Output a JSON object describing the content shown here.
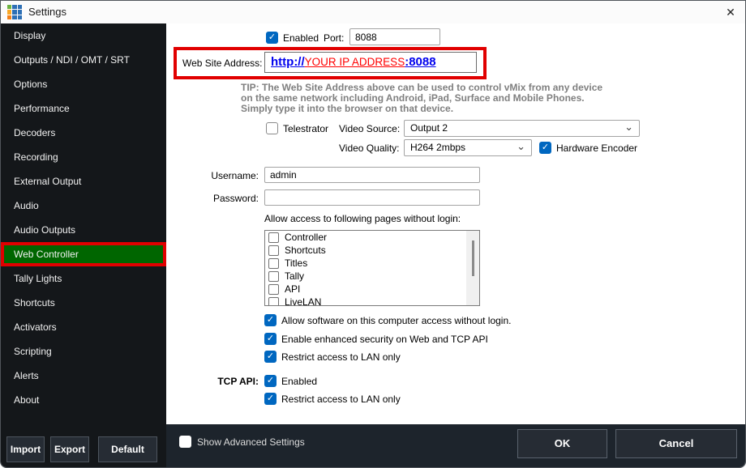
{
  "window": {
    "title": "Settings"
  },
  "icons": {
    "close": "✕",
    "check": "✓",
    "chevron_down": "⌄"
  },
  "sidebar": {
    "items": [
      "Display",
      "Outputs / NDI / OMT / SRT",
      "Options",
      "Performance",
      "Decoders",
      "Recording",
      "External Output",
      "Audio",
      "Audio Outputs",
      "Web Controller",
      "Tally Lights",
      "Shortcuts",
      "Activators",
      "Scripting",
      "Alerts",
      "About"
    ],
    "selected_item": "Web Controller",
    "buttons": {
      "import": "Import",
      "export": "Export",
      "default": "Default"
    }
  },
  "content": {
    "enabled_label": "Enabled",
    "port_label": "Port:",
    "port_value": "8088",
    "website": {
      "label": "Web Site Address:",
      "prefix": "http://",
      "middle": "YOUR IP ADDRESS",
      "suffix": ":8088"
    },
    "tip_lines": [
      "TIP: The Web Site Address above can be used to control vMix from any device",
      "on the same network including Android, iPad, Surface and Mobile Phones.",
      "Simply type it into the browser on that device."
    ],
    "telestrator_label": "Telestrator",
    "video_source_label": "Video Source:",
    "video_source_value": "Output 2",
    "video_quality_label": "Video Quality:",
    "video_quality_value": "H264 2mbps",
    "hardware_encoder_label": "Hardware Encoder",
    "username_label": "Username:",
    "username_value": "admin",
    "password_label": "Password:",
    "password_value": "",
    "allow_pages_label": "Allow access to following pages without login:",
    "allow_pages_items": [
      "Controller",
      "Shortcuts",
      "Titles",
      "Tally",
      "API",
      "LiveLAN"
    ],
    "access_checks": [
      "Allow software on this computer access without login.",
      "Enable enhanced security on Web and TCP API",
      "Restrict access to LAN only"
    ],
    "tcp_api_label": "TCP API:",
    "tcp_enabled_label": "Enabled",
    "tcp_restrict_label": "Restrict access to LAN only"
  },
  "footer": {
    "advanced_label": "Show Advanced Settings",
    "ok_label": "OK",
    "cancel_label": "Cancel"
  },
  "colors": {
    "selected_green": "#006600",
    "annotation_red": "#e10000",
    "accent_blue": "#0067c0",
    "link_blue": "#0000ee",
    "link_red": "#ff0000",
    "sidebar_bg": "#14171a",
    "footer_bg": "#1d242c"
  }
}
